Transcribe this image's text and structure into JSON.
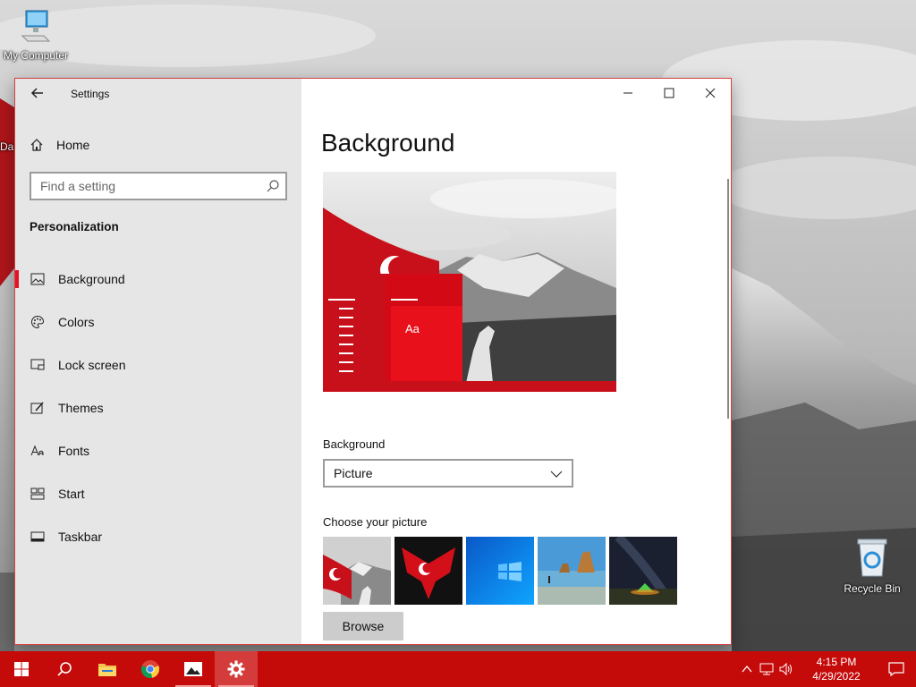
{
  "desktop": {
    "icons": [
      {
        "name": "My Computer"
      },
      {
        "name": "Recycle Bin"
      }
    ],
    "partial_label": "Da"
  },
  "window": {
    "app_title": "Settings",
    "home_label": "Home",
    "search": {
      "placeholder": "Find a setting"
    },
    "section": "Personalization",
    "nav": [
      {
        "label": "Background",
        "icon": "picture-icon",
        "active": true
      },
      {
        "label": "Colors",
        "icon": "palette-icon"
      },
      {
        "label": "Lock screen",
        "icon": "lock-screen-icon"
      },
      {
        "label": "Themes",
        "icon": "themes-icon"
      },
      {
        "label": "Fonts",
        "icon": "fonts-icon"
      },
      {
        "label": "Start",
        "icon": "start-icon"
      },
      {
        "label": "Taskbar",
        "icon": "taskbar-icon"
      }
    ],
    "controls": {
      "minimize": "minimize-icon",
      "maximize": "maximize-icon",
      "close": "close-icon"
    }
  },
  "content": {
    "title": "Background",
    "preview_sample_text": "Aa",
    "background_label": "Background",
    "background_value": "Picture",
    "choose_label": "Choose your picture",
    "thumbnails": [
      "Turkish flag and wolf",
      "Red flag wings",
      "Windows blue",
      "Beach rocks",
      "Night sky tent"
    ],
    "browse_label": "Browse"
  },
  "taskbar": {
    "apps": [
      "start-icon",
      "search-icon",
      "file-explorer-icon",
      "chrome-icon",
      "photos-icon",
      "settings-icon"
    ],
    "time": "4:15 PM",
    "date": "4/29/2022"
  },
  "colors": {
    "accent": "#e81123",
    "taskbar": "#c50a0a"
  }
}
